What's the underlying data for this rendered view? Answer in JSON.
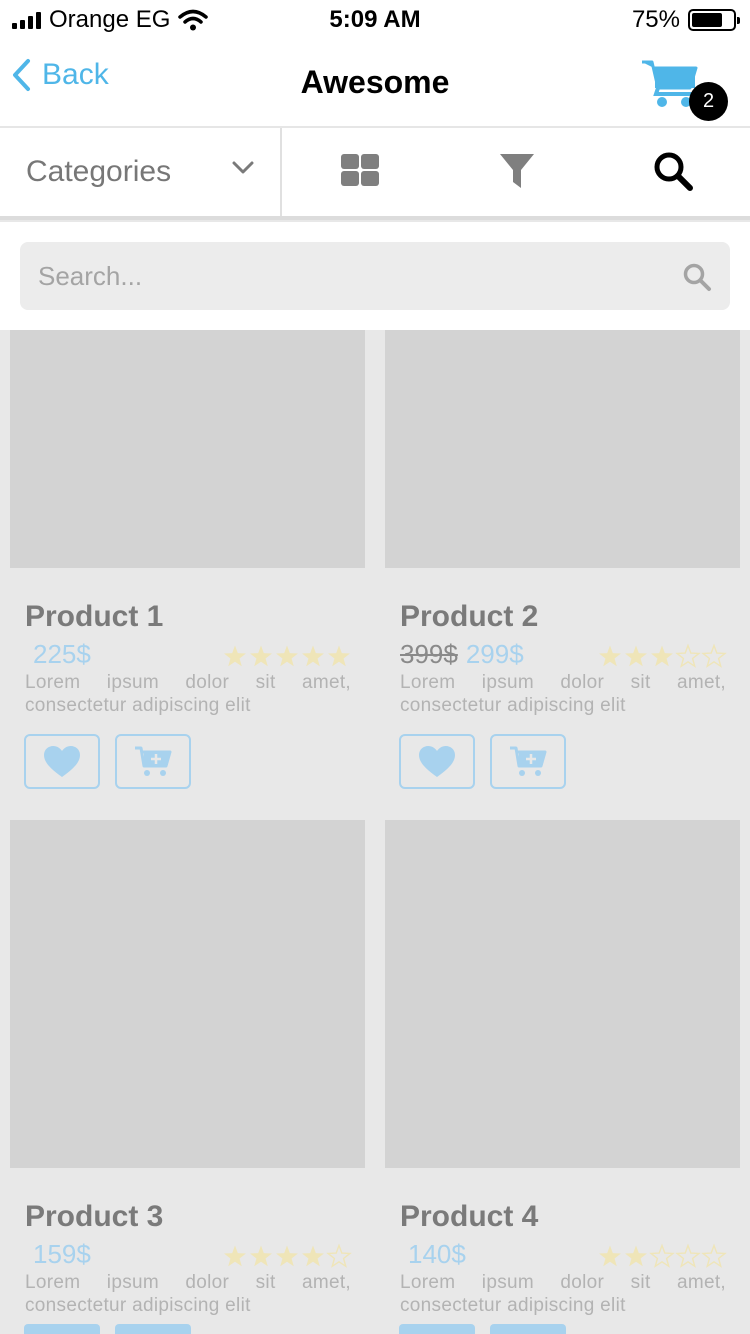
{
  "status_bar": {
    "carrier": "Orange EG",
    "time": "5:09 AM",
    "battery_percent": "75%",
    "battery_level": 0.75
  },
  "nav": {
    "back_label": "Back",
    "title": "Awesome",
    "cart_count": "2"
  },
  "toolbar": {
    "categories_label": "Categories",
    "icons": [
      "grid-icon",
      "filter-icon",
      "search-icon"
    ]
  },
  "search": {
    "placeholder": "Search..."
  },
  "colors": {
    "accent": "#4fb6e8",
    "accent_faded": "#a8d2ee",
    "star_filled": "#efe5b8",
    "star_empty": "#efe5b8",
    "image_placeholder": "#d3d3d3"
  },
  "products": [
    {
      "name": "Product 1",
      "old_price": "",
      "price": "225$",
      "rating": 5,
      "description": "Lorem ipsum dolor sit amet, consectetur adipiscing elit"
    },
    {
      "name": "Product 2",
      "old_price": "399$",
      "price": "299$",
      "rating": 3,
      "description": "Lorem ipsum dolor sit amet, consectetur adipiscing elit"
    },
    {
      "name": "Product 3",
      "old_price": "",
      "price": "159$",
      "rating": 4,
      "description": "Lorem ipsum dolor sit amet, consectetur adipiscing elit"
    },
    {
      "name": "Product 4",
      "old_price": "",
      "price": "140$",
      "rating": 2,
      "description": "Lorem ipsum dolor sit amet, consectetur adipiscing elit"
    }
  ]
}
